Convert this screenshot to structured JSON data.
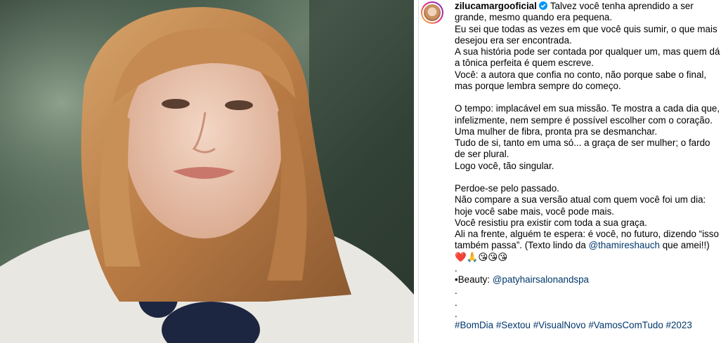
{
  "post": {
    "username": "zilucamargooficial",
    "caption": {
      "line_1": "Talvez você tenha aprendido a ser\ngrande, mesmo quando era pequena.\nEu sei que todas as vezes em que você quis sumir, o que mais desejou era ser encontrada.\nA sua história pode ser contada por qualquer um, mas quem dá a tônica perfeita é quem escreve.\nVocê: a autora que confia no conto, não porque sabe o final, mas porque lembra sempre do começo.\n\nO tempo: implacável em sua missão. Te mostra a cada dia que, infelizmente, nem sempre é possível escolher com o coração.\nUma mulher de fibra, pronta pra se desmanchar.\nTudo de si, tanto em uma só... a graça de ser mulher; o fardo de ser plural.\nLogo você, tão singular.\n\nPerdoe-se pelo passado.\nNão compare a sua versão atual com quem você foi um dia: hoje você sabe mais, você pode mais.\nVocê resistiu pra existir com toda a sua graça.\nAli na frente, alguém te espera: é você, no futuro, dizendo “isso também passa”. (Texto lindo da ",
      "mention_1": "@thamireshauch",
      "after_mention_1": " que amei!!) ",
      "emojis": "❤️🙏😘😘😘",
      "dots_1": "\n.\n•Beauty: ",
      "mention_2": "@patyhairsalonandspa",
      "dots_2": "\n.\n.\n.\n",
      "hashtags": [
        "#BomDia",
        "#Sextou",
        "#VisualNovo",
        "#VamosComTudo",
        "#2023"
      ]
    }
  },
  "icons": {
    "verified": "verified-badge-icon",
    "avatar": "profile-avatar"
  },
  "colors": {
    "link": "#00376b",
    "verified_blue": "#0095f6",
    "text": "#000000"
  }
}
